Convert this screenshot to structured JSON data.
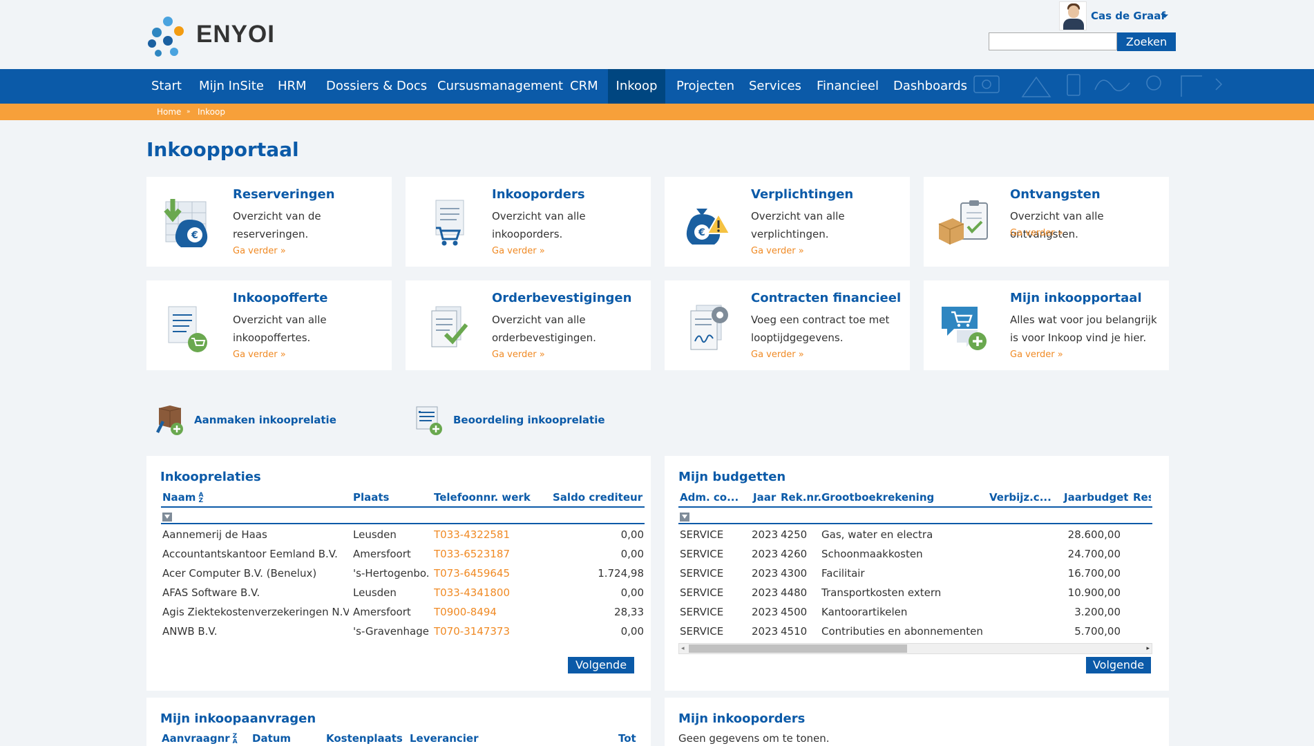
{
  "brand": {
    "name": "ENYOI"
  },
  "user": {
    "name": "Cas de Graaf"
  },
  "search": {
    "value": "",
    "button": "Zoeken"
  },
  "nav": [
    {
      "label": "Start"
    },
    {
      "label": "Mijn InSite"
    },
    {
      "label": "HRM"
    },
    {
      "label": "Dossiers & Docs"
    },
    {
      "label": "Cursusmanagement"
    },
    {
      "label": "CRM"
    },
    {
      "label": "Inkoop"
    },
    {
      "label": "Projecten"
    },
    {
      "label": "Services"
    },
    {
      "label": "Financieel"
    },
    {
      "label": "Dashboards"
    }
  ],
  "breadcrumb": {
    "home": "Home",
    "current": "Inkoop",
    "separator": "»"
  },
  "page": {
    "title": "Inkoopportaal"
  },
  "tiles": [
    {
      "title": "Reserveringen",
      "desc": "Overzicht van de reserveringen.",
      "link": "Ga verder »",
      "icon": "reservations-icon"
    },
    {
      "title": "Inkooporders",
      "desc": "Overzicht van alle inkooporders.",
      "link": "Ga verder »",
      "icon": "purchase-orders-icon"
    },
    {
      "title": "Verplichtingen",
      "desc": "Overzicht van alle verplichtingen.",
      "link": "Ga verder »",
      "icon": "obligations-icon"
    },
    {
      "title": "Ontvangsten",
      "desc": "Overzicht van alle ontvangsten.",
      "link": "Ga verder »",
      "icon": "receipts-icon"
    },
    {
      "title": "Inkoopofferte",
      "desc": "Overzicht van alle inkoopoffertes.",
      "link": "Ga verder »",
      "icon": "purchase-quote-icon"
    },
    {
      "title": "Orderbevestigingen",
      "desc": "Overzicht van alle orderbevestigingen.",
      "link": "Ga verder »",
      "icon": "order-confirmations-icon"
    },
    {
      "title": "Contracten financieel",
      "desc": "Voeg een contract toe met looptijdgegevens.",
      "link": "Ga verder »",
      "icon": "contracts-icon"
    },
    {
      "title": "Mijn inkoopportaal",
      "desc": "Alles wat voor jou belangrijk is voor Inkoop vind je hier.",
      "link": "Ga verder »",
      "icon": "my-portal-icon"
    }
  ],
  "quick_links": [
    {
      "label": "Aanmaken inkooprelatie",
      "icon": "create-relation-icon"
    },
    {
      "label": "Beoordeling inkooprelatie",
      "icon": "assess-relation-icon"
    }
  ],
  "relations": {
    "title": "Inkooprelaties",
    "columns": [
      "Naam",
      "Plaats",
      "Telefoonnr. werk",
      "Saldo crediteur"
    ],
    "rows": [
      [
        "Aannemerij de Haas",
        "Leusden",
        "T033-4322581",
        "0,00"
      ],
      [
        "Accountantskantoor Eemland B.V.",
        "Amersfoort",
        "T033-6523187",
        "0,00"
      ],
      [
        "Acer Computer B.V. (Benelux)",
        "'s-Hertogenbo...",
        "T073-6459645",
        "1.724,98"
      ],
      [
        "AFAS Software B.V.",
        "Leusden",
        "T033-4341800",
        "0,00"
      ],
      [
        "Agis Ziektekostenverzekeringen N.V.",
        "Amersfoort",
        "T0900-8494",
        "28,33"
      ],
      [
        "ANWB B.V.",
        "'s-Gravenhage",
        "T070-3147373",
        "0,00"
      ]
    ],
    "next": "Volgende"
  },
  "budgets": {
    "title": "Mijn budgetten",
    "columns": [
      "Adm. co...",
      "Jaar",
      "Rek.nr.",
      "Grootboekrekening",
      "Verbijz.c...",
      "Jaarbudget",
      "Rese"
    ],
    "rows": [
      [
        "SERVICE",
        "2023",
        "4250",
        "Gas, water en electra",
        "",
        "28.600,00"
      ],
      [
        "SERVICE",
        "2023",
        "4260",
        "Schoonmaakkosten",
        "",
        "24.700,00"
      ],
      [
        "SERVICE",
        "2023",
        "4300",
        "Facilitair",
        "",
        "16.700,00"
      ],
      [
        "SERVICE",
        "2023",
        "4480",
        "Transportkosten extern",
        "",
        "10.900,00"
      ],
      [
        "SERVICE",
        "2023",
        "4500",
        "Kantoorartikelen",
        "",
        "3.200,00"
      ],
      [
        "SERVICE",
        "2023",
        "4510",
        "Contributies en abonnementen",
        "",
        "5.700,00"
      ]
    ],
    "next": "Volgende"
  },
  "requests": {
    "title": "Mijn inkoopaanvragen",
    "columns": [
      "Aanvraagnr",
      "Datum",
      "Kostenplaats",
      "Leverancier",
      "Tot"
    ]
  },
  "my_orders": {
    "title": "Mijn inkooporders",
    "empty": "Geen gegevens om te tonen."
  },
  "colors": {
    "primary": "#0b5aa8",
    "accent": "#f7a03a",
    "link": "#f08a24"
  }
}
